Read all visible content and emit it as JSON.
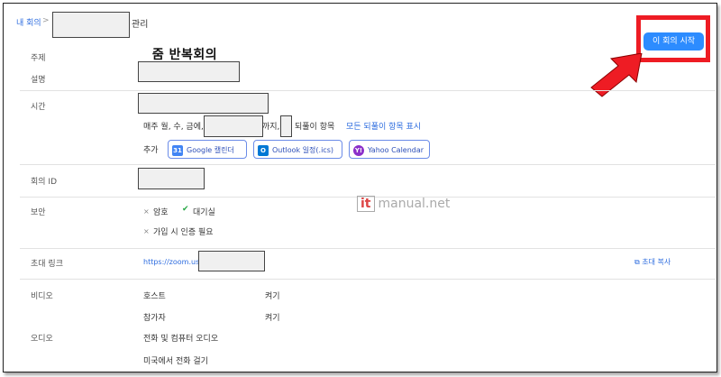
{
  "breadcrumb": {
    "home": "내 회의",
    "separator": ">",
    "current": "관리"
  },
  "header": {
    "start_button": "이 회의 시작"
  },
  "topic": {
    "label": "주제",
    "value": "줌 반복회의"
  },
  "description": {
    "label": "설명"
  },
  "time": {
    "label": "시간",
    "recurrence_prefix": "매주 월, 수, 금에,",
    "recurrence_until": "까지,",
    "recurrence_suffix": "되풀이 항목",
    "show_all_link": "모든 되풀이 항목 표시",
    "add_label": "추가",
    "calendars": [
      {
        "name": "google",
        "label": "Google 캘린더",
        "icon": "31",
        "color": "#4285f4"
      },
      {
        "name": "outlook",
        "label": "Outlook 일정(.ics)",
        "icon": "O",
        "color": "#0078d4"
      },
      {
        "name": "yahoo",
        "label": "Yahoo Calendar",
        "icon": "Y!",
        "color": "#8b2fc9"
      }
    ]
  },
  "meeting_id": {
    "label": "회의 ID"
  },
  "security": {
    "label": "보안",
    "items": [
      {
        "mark": "×",
        "text": "암호"
      },
      {
        "mark": "✔",
        "text": "대기실"
      },
      {
        "mark": "×",
        "text": "가입 시 인증 필요"
      }
    ]
  },
  "invite": {
    "label": "초대 링크",
    "url": "https://zoom.us/j",
    "copy": "초대 복사"
  },
  "video": {
    "label": "비디오",
    "host_label": "호스트",
    "host_value": "켜기",
    "participant_label": "참가자",
    "participant_value": "켜기"
  },
  "audio": {
    "label": "오디오",
    "option1": "전화 및 컴퓨터 오디오",
    "option2": "미국에서 전화 걸기"
  },
  "watermark": {
    "box": "it",
    "text": "manual.net"
  },
  "colors": {
    "accent": "#2d8cff",
    "highlight": "#ee1c24",
    "link": "#2d6cdf"
  }
}
